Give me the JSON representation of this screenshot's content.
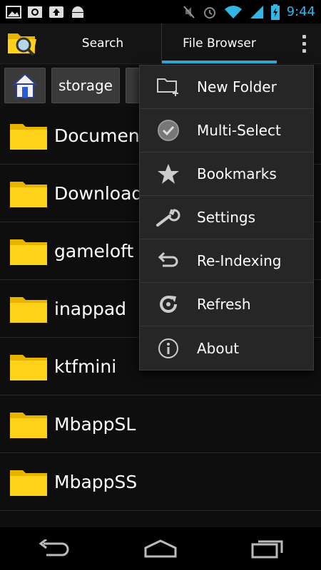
{
  "status": {
    "time": "9:44",
    "icons": [
      "picture-icon",
      "image-search-icon",
      "upload-icon",
      "android-icon",
      "mute-icon",
      "alarm-icon",
      "wifi-icon",
      "signal-icon",
      "battery-icon"
    ]
  },
  "actionbar": {
    "tabs": [
      {
        "label": "Search"
      },
      {
        "label": "File Browser"
      }
    ],
    "accent": "#33b5e5"
  },
  "breadcrumb": {
    "items": [
      {
        "label": "storage"
      }
    ]
  },
  "files": [
    {
      "name": "Documents"
    },
    {
      "name": "Download"
    },
    {
      "name": "gameloft"
    },
    {
      "name": "inappad"
    },
    {
      "name": "ktfmini"
    },
    {
      "name": "MbappSL"
    },
    {
      "name": "MbappSS"
    }
  ],
  "menu": {
    "items": [
      {
        "label": "New Folder",
        "icon": "new-folder-icon"
      },
      {
        "label": "Multi-Select",
        "icon": "check-icon"
      },
      {
        "label": "Bookmarks",
        "icon": "star-icon"
      },
      {
        "label": "Settings",
        "icon": "wrench-icon"
      },
      {
        "label": "Re-Indexing",
        "icon": "undo-icon"
      },
      {
        "label": "Refresh",
        "icon": "refresh-icon"
      },
      {
        "label": "About",
        "icon": "info-icon"
      }
    ]
  }
}
